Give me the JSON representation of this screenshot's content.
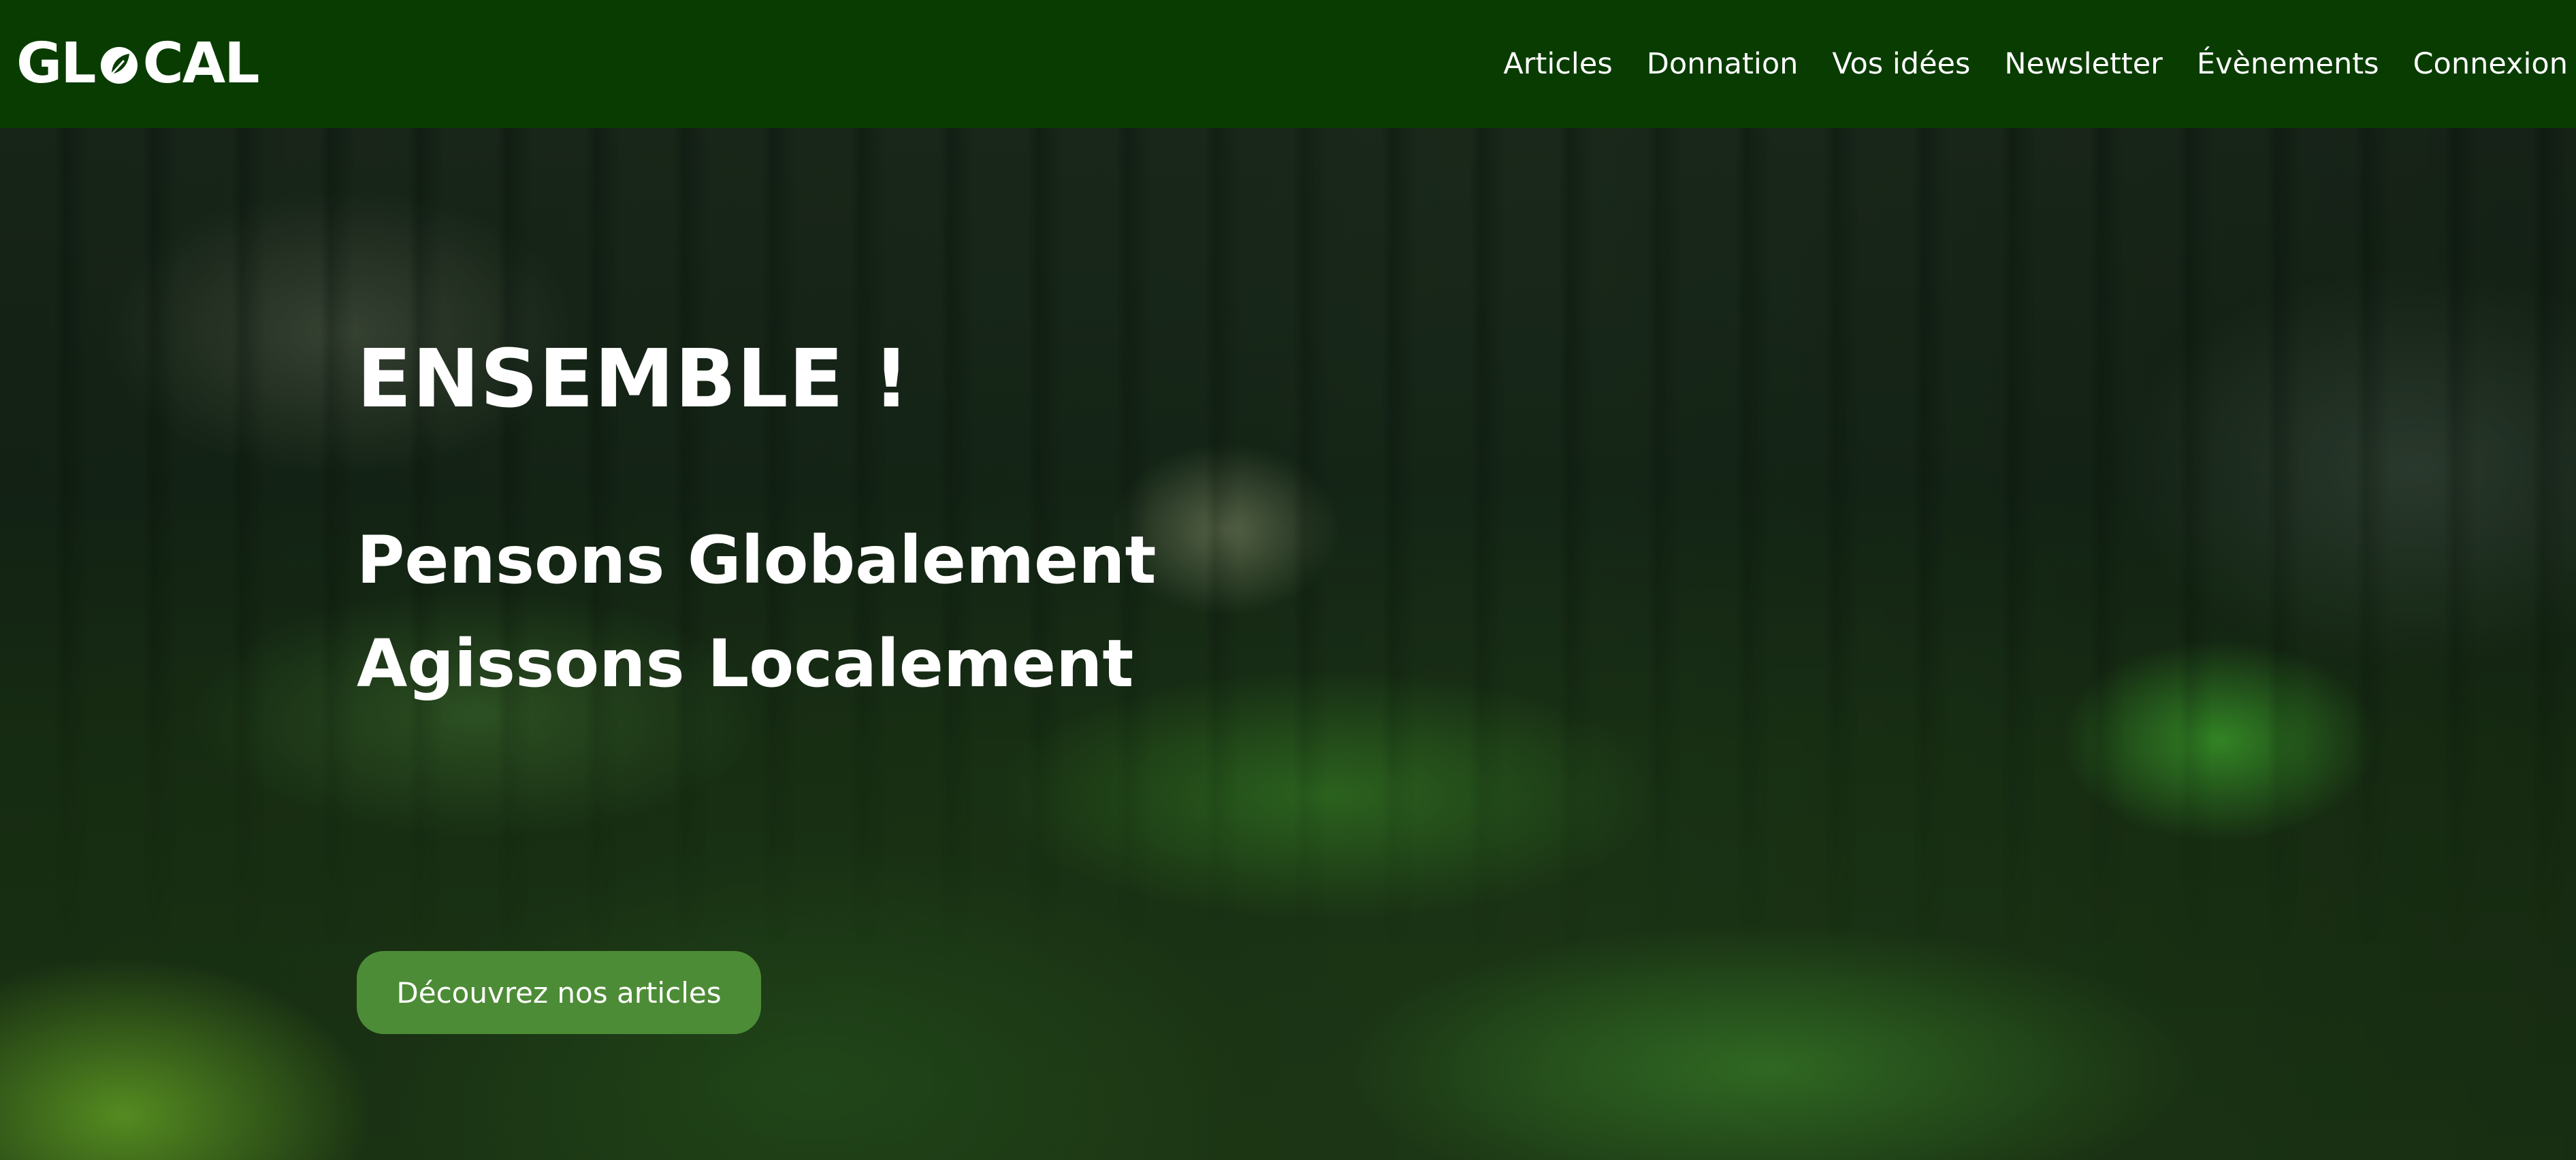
{
  "header": {
    "logo": {
      "text_before": "GL",
      "text_after": "CAL",
      "icon": "leaf-icon"
    },
    "nav": [
      {
        "label": "Articles"
      },
      {
        "label": "Donnation"
      },
      {
        "label": "Vos idées"
      },
      {
        "label": "Newsletter"
      },
      {
        "label": "Évènements"
      },
      {
        "label": "Connexion"
      }
    ]
  },
  "hero": {
    "title": "ENSEMBLE !",
    "line1": "Pensons Globalement",
    "line2": "Agissons Localement",
    "cta_label": "Découvrez nos articles",
    "background": "blurred-forest-photo"
  },
  "colors": {
    "navbar": "#093c00",
    "cta": "#4d8c36",
    "text": "#ffffff"
  }
}
